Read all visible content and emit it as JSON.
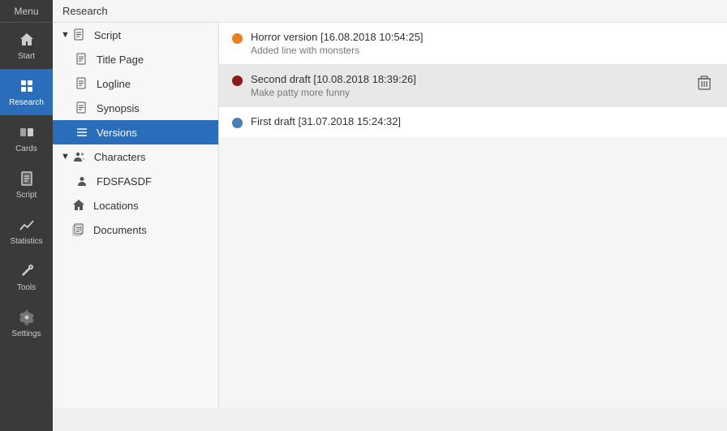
{
  "menu": {
    "label": "Menu"
  },
  "top_header": {
    "title": "Research"
  },
  "icon_sidebar": {
    "items": [
      {
        "id": "start",
        "label": "Start",
        "icon": "home-icon"
      },
      {
        "id": "research",
        "label": "Research",
        "icon": "research-icon",
        "active": true
      },
      {
        "id": "cards",
        "label": "Cards",
        "icon": "cards-icon"
      },
      {
        "id": "script",
        "label": "Script",
        "icon": "script-icon"
      },
      {
        "id": "statistics",
        "label": "Statistics",
        "icon": "statistics-icon"
      },
      {
        "id": "tools",
        "label": "Tools",
        "icon": "tools-icon"
      },
      {
        "id": "settings",
        "label": "Settings",
        "icon": "settings-icon"
      }
    ]
  },
  "tree": {
    "items": [
      {
        "id": "script",
        "label": "Script",
        "icon": "doc-icon",
        "indent": 0,
        "expandable": true,
        "expanded": true
      },
      {
        "id": "title-page",
        "label": "Title Page",
        "icon": "page-icon",
        "indent": 1
      },
      {
        "id": "logline",
        "label": "Logline",
        "icon": "page-icon",
        "indent": 1
      },
      {
        "id": "synopsis",
        "label": "Synopsis",
        "icon": "page-icon",
        "indent": 1
      },
      {
        "id": "versions",
        "label": "Versions",
        "icon": "list-icon",
        "indent": 1,
        "active": true
      },
      {
        "id": "characters",
        "label": "Characters",
        "icon": "people-icon",
        "indent": 0,
        "expandable": true,
        "expanded": true
      },
      {
        "id": "fdsfasdf",
        "label": "FDSFASDF",
        "icon": "person-icon",
        "indent": 1
      },
      {
        "id": "locations",
        "label": "Locations",
        "icon": "home2-icon",
        "indent": 0,
        "expandable": false
      },
      {
        "id": "documents",
        "label": "Documents",
        "icon": "docs-icon",
        "indent": 0,
        "expandable": false
      }
    ]
  },
  "versions": {
    "items": [
      {
        "id": "v1",
        "title": "Horror version [16.08.2018 10:54:25]",
        "description": "Added line with monsters",
        "dot_color": "#e88020",
        "has_delete": false
      },
      {
        "id": "v2",
        "title": "Second draft [10.08.2018 18:39:26]",
        "description": "Make patty more funny",
        "dot_color": "#8b1a1a",
        "has_delete": true
      },
      {
        "id": "v3",
        "title": "First draft [31.07.2018 15:24:32]",
        "description": "",
        "dot_color": "#4a7fb5",
        "has_delete": false
      }
    ]
  }
}
